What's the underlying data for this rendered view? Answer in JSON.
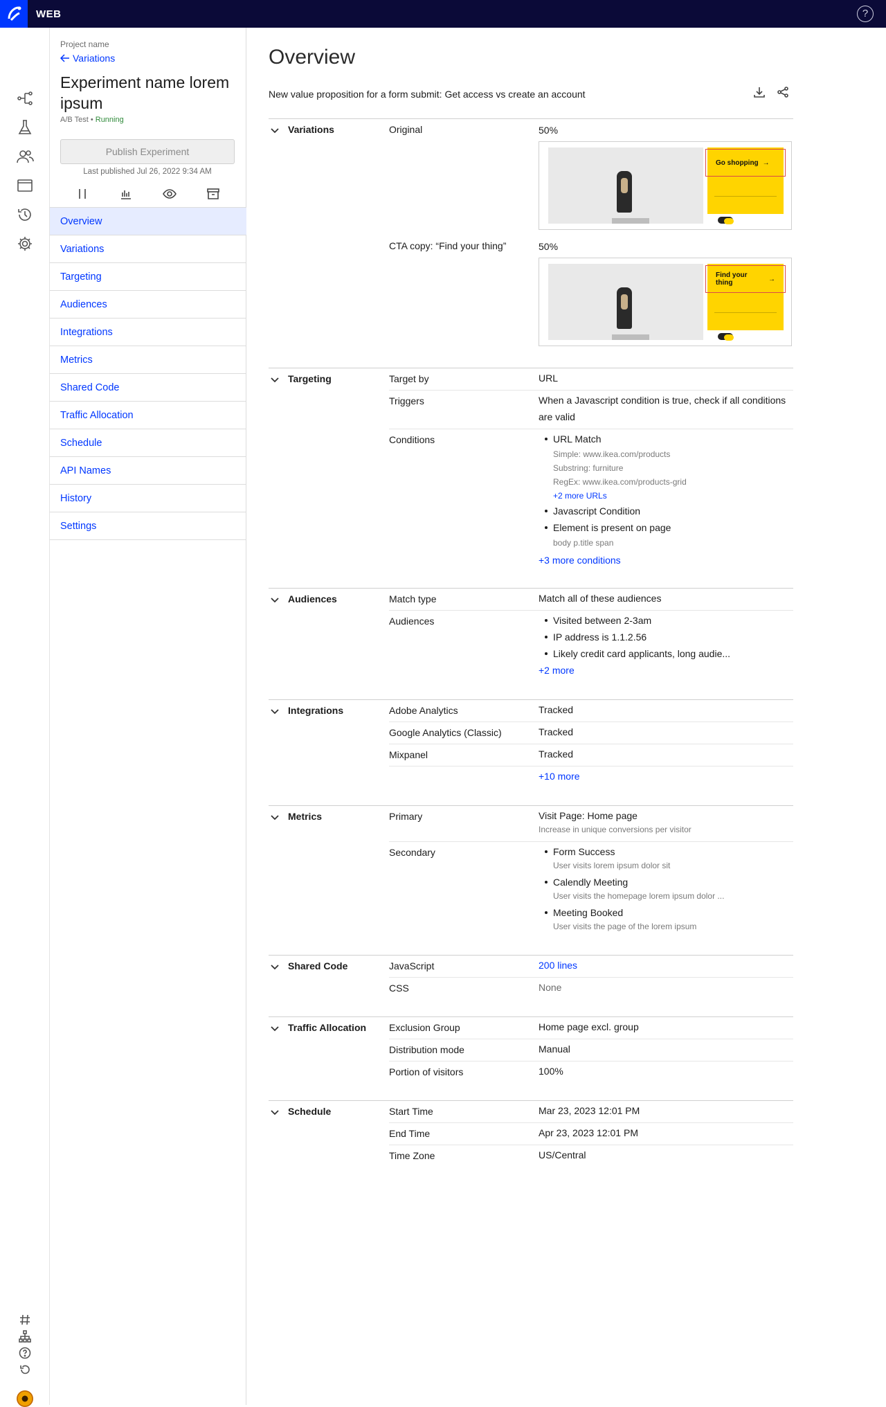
{
  "app": {
    "title": "WEB"
  },
  "sidebar": {
    "project_label": "Project name",
    "back_label": "Variations",
    "experiment_name": "Experiment name lorem ipsum",
    "experiment_type": "A/B Test",
    "status": "Running",
    "publish_label": "Publish Experiment",
    "last_published": "Last published Jul 26, 2022 9:34 AM",
    "tools": [
      "pause-icon",
      "results-chart-icon",
      "preview-eye-icon",
      "archive-icon"
    ],
    "nav": [
      "Overview",
      "Variations",
      "Targeting",
      "Audiences",
      "Integrations",
      "Metrics",
      "Shared Code",
      "Traffic Allocation",
      "Schedule",
      "API Names",
      "History",
      "Settings"
    ],
    "active_nav": "Overview"
  },
  "rail": {
    "icons": [
      "flows-icon",
      "experiments-flask-icon",
      "audiences-people-icon",
      "browser-window-icon",
      "history-icon",
      "settings-gear-icon"
    ],
    "bottom_icons": [
      "hash-icon",
      "sitemap-icon",
      "help-icon",
      "undo-icon"
    ]
  },
  "main": {
    "title": "Overview",
    "description": "New value proposition for a form submit: Get access vs create an account",
    "actions": [
      "download-icon",
      "share-icon"
    ],
    "variations": {
      "heading": "Variations",
      "items": [
        {
          "name": "Original",
          "split": "50%",
          "cta": "Go shopping"
        },
        {
          "name": "CTA copy:  “Find your thing”",
          "split": "50%",
          "cta": "Find your thing"
        }
      ]
    },
    "targeting": {
      "heading": "Targeting",
      "target_by_label": "Target by",
      "target_by": "URL",
      "triggers_label": "Triggers",
      "triggers": "When a Javascript condition is true, check if all conditions are valid",
      "conditions_label": "Conditions",
      "url_match": "URL Match",
      "url_simple": "Simple: www.ikea.com/products",
      "url_substring": "Substring: furniture",
      "url_regex": "RegEx: www.ikea.com/products-grid",
      "url_more": "+2 more URLs",
      "js_condition": "Javascript Condition",
      "element_present": "Element is present on page",
      "element_selector": "body p.title span",
      "more_conditions": "+3 more conditions"
    },
    "audiences": {
      "heading": "Audiences",
      "match_type_label": "Match type",
      "match_type": "Match all of these audiences",
      "audiences_label": "Audiences",
      "items": [
        "Visited between 2-3am",
        "IP address is 1.1.2.56",
        "Likely credit card applicants, long audie..."
      ],
      "more": "+2 more"
    },
    "integrations": {
      "heading": "Integrations",
      "items": [
        {
          "name": "Adobe Analytics",
          "value": "Tracked"
        },
        {
          "name": "Google Analytics (Classic)",
          "value": "Tracked"
        },
        {
          "name": "Mixpanel",
          "value": "Tracked"
        }
      ],
      "more": "+10 more"
    },
    "metrics": {
      "heading": "Metrics",
      "primary_label": "Primary",
      "primary": "Visit Page: Home page",
      "primary_sub": "Increase in unique conversions per visitor",
      "secondary_label": "Secondary",
      "secondary": [
        {
          "name": "Form Success",
          "sub": "User visits lorem ipsum dolor sit"
        },
        {
          "name": "Calendly Meeting",
          "sub": "User visits the homepage lorem ipsum dolor ..."
        },
        {
          "name": "Meeting Booked",
          "sub": "User visits the page of the lorem ipsum"
        }
      ]
    },
    "shared_code": {
      "heading": "Shared Code",
      "js_label": "JavaScript",
      "js_value": "200 lines",
      "css_label": "CSS",
      "css_value": "None"
    },
    "traffic": {
      "heading": "Traffic Allocation",
      "exclusion_label": "Exclusion Group",
      "exclusion": "Home page excl. group",
      "mode_label": "Distribution mode",
      "mode": "Manual",
      "portion_label": "Portion of visitors",
      "portion": "100%"
    },
    "schedule": {
      "heading": "Schedule",
      "start_label": "Start Time",
      "start": "Mar 23, 2023 12:01 PM",
      "end_label": "End Time",
      "end": "Apr 23, 2023 12:01 PM",
      "tz_label": "Time Zone",
      "tz": "US/Central"
    }
  }
}
